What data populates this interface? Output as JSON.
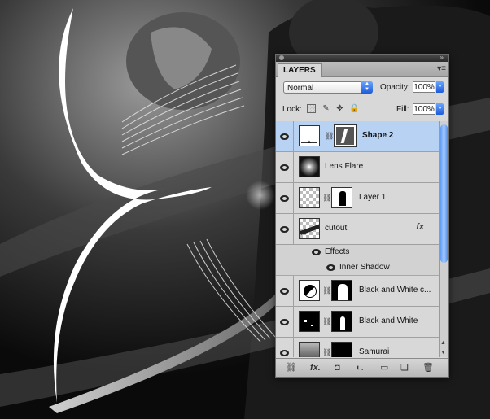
{
  "panel": {
    "tab_label": "LAYERS",
    "menu_icon": "panel-menu-icon"
  },
  "blend": {
    "mode": "Normal",
    "opacity_label": "Opacity:",
    "opacity_value": "100%"
  },
  "lock": {
    "label": "Lock:",
    "fill_label": "Fill:",
    "fill_value": "100%",
    "icons": [
      "lock-transparent-icon",
      "lock-image-icon",
      "lock-position-icon",
      "lock-all-icon"
    ]
  },
  "layers": [
    {
      "name": "Shape 2",
      "selected": true
    },
    {
      "name": "Lens Flare",
      "selected": false
    },
    {
      "name": "Layer 1",
      "selected": false
    },
    {
      "name": "cutout",
      "selected": false,
      "fx": "fx"
    },
    {
      "name": "Black and White c...",
      "selected": false
    },
    {
      "name": "Black and White",
      "selected": false
    },
    {
      "name": "Samurai",
      "selected": false
    }
  ],
  "effects": {
    "label": "Effects",
    "items": [
      "Inner Shadow"
    ]
  },
  "bottom_icons": [
    "link-layers-icon",
    "fx-icon",
    "add-mask-icon",
    "adjustment-layer-icon",
    "new-group-icon",
    "new-layer-icon",
    "trash-icon"
  ],
  "colors": {
    "selection": "#b8d2f4",
    "accent_blue": "#1e5bd8",
    "panel_bg": "#d8d8d8"
  }
}
